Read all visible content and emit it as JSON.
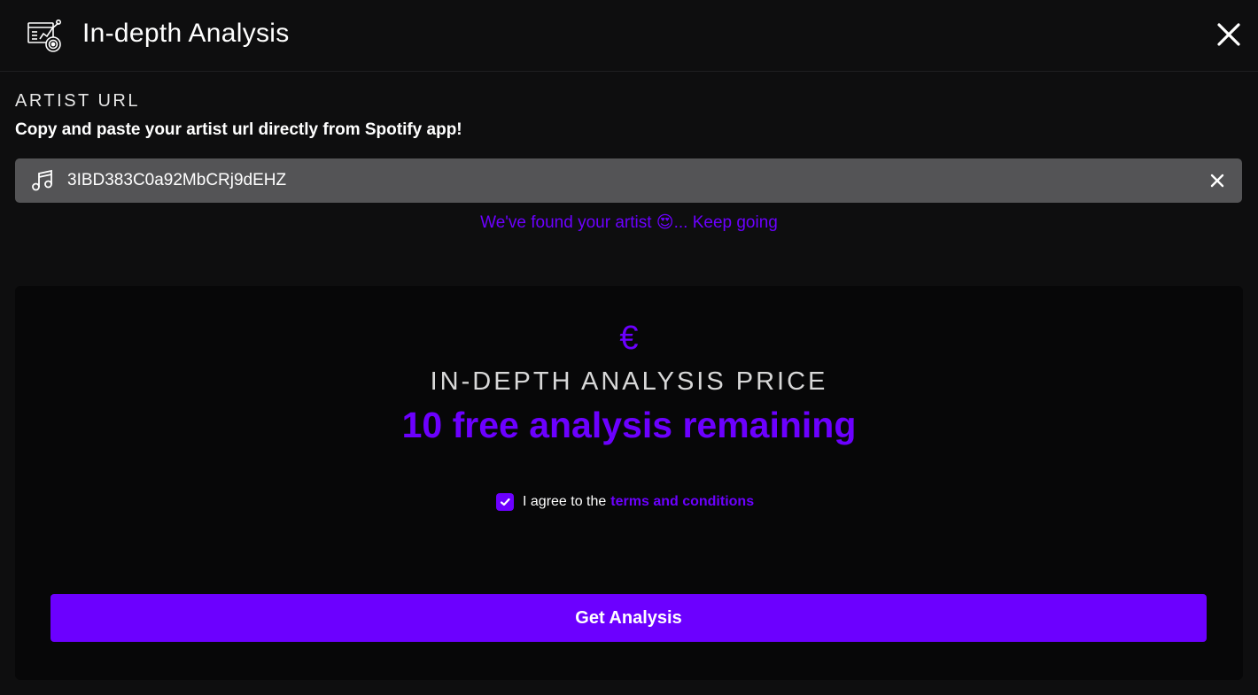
{
  "header": {
    "title": "In-depth Analysis",
    "icon": "analytics-report-icon",
    "close_icon": "close-icon"
  },
  "artist_url": {
    "label": "ARTIST URL",
    "hint": "Copy and paste your artist url directly from Spotify app!",
    "value": "3IBD383C0a92MbCRj9dEHZ",
    "field_icon": "music-note-icon",
    "clear_icon": "clear-icon",
    "status_message": "We've found your artist 😍... Keep going"
  },
  "pricing": {
    "currency_icon": "€",
    "label": "IN-DEPTH ANALYSIS PRICE",
    "free_remaining": "10 free analysis remaining",
    "agree_prefix": "I agree to the",
    "terms_link": "terms and conditions",
    "agree_checked": true,
    "button_label": "Get Analysis"
  },
  "colors": {
    "accent": "#6c00ff",
    "background": "#0e0e0f",
    "card": "#070708",
    "field": "#545456"
  }
}
